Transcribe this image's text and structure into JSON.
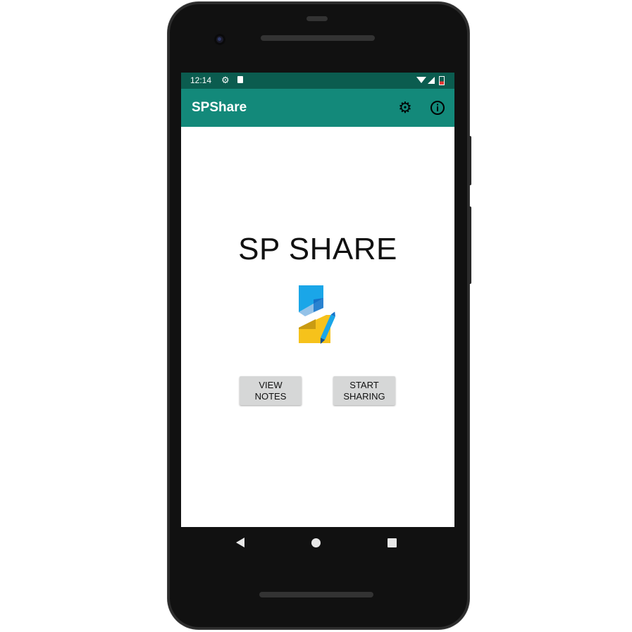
{
  "status_bar": {
    "time": "12:14",
    "icons": [
      "gear-icon",
      "sd-card-icon",
      "wifi-icon",
      "signal-icon",
      "battery-icon"
    ]
  },
  "app_bar": {
    "title": "SPShare",
    "icons": [
      "settings-gear-icon",
      "info-icon"
    ]
  },
  "main": {
    "headline": "SP SHARE",
    "logo": "sp-share-logo"
  },
  "buttons": {
    "view_notes": "VIEW\nNOTES",
    "start_sharing": "START\nSHARING"
  },
  "navigation": {
    "icons": [
      "back-icon",
      "home-icon",
      "recents-icon"
    ]
  },
  "colors": {
    "status_bar": "#0b5c4f",
    "app_bar": "#13897a",
    "button": "#d6d7d7",
    "logo_blue": "#1aa6e8",
    "logo_yellow": "#f6c21b"
  }
}
